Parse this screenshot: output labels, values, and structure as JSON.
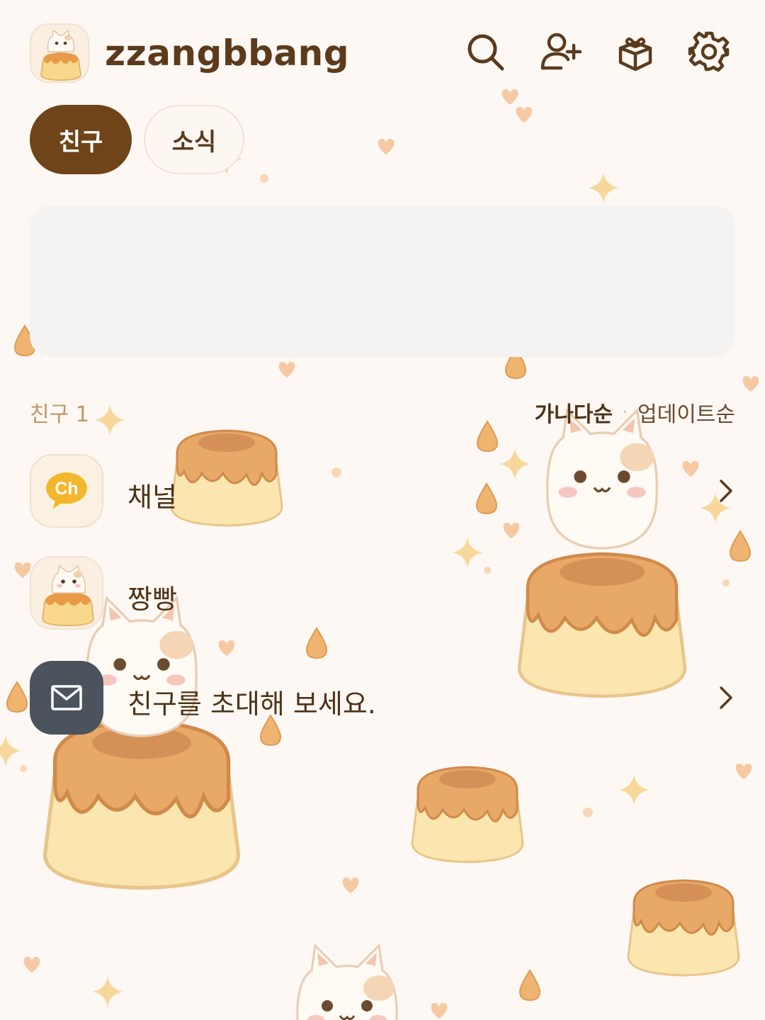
{
  "header": {
    "profile_name": "zzangbbang",
    "icons": [
      "search-icon",
      "add-friend-icon",
      "gift-icon",
      "settings-icon"
    ]
  },
  "tabs": [
    {
      "label": "친구",
      "active": true
    },
    {
      "label": "소식",
      "active": false
    }
  ],
  "friends_section": {
    "count_label": "친구 1",
    "sort_active": "가나다순",
    "sort_separator": "·",
    "sort_inactive": "업데이트순"
  },
  "rows": [
    {
      "label": "채널",
      "icon": "channel-icon",
      "icon_text": "Ch",
      "has_chevron": true
    },
    {
      "label": "짱빵",
      "icon": "cat-pudding-avatar",
      "has_chevron": false
    },
    {
      "label": "친구를 초대해 보세요.",
      "icon": "envelope-icon",
      "has_chevron": true
    }
  ],
  "colors": {
    "background": "#fdf8f4",
    "accent": "#6e4418",
    "text_primary": "#4e3318",
    "text_muted": "#c29468",
    "invite_avatar_bg": "#4b535d",
    "channel_icon": "#f4b62a"
  }
}
